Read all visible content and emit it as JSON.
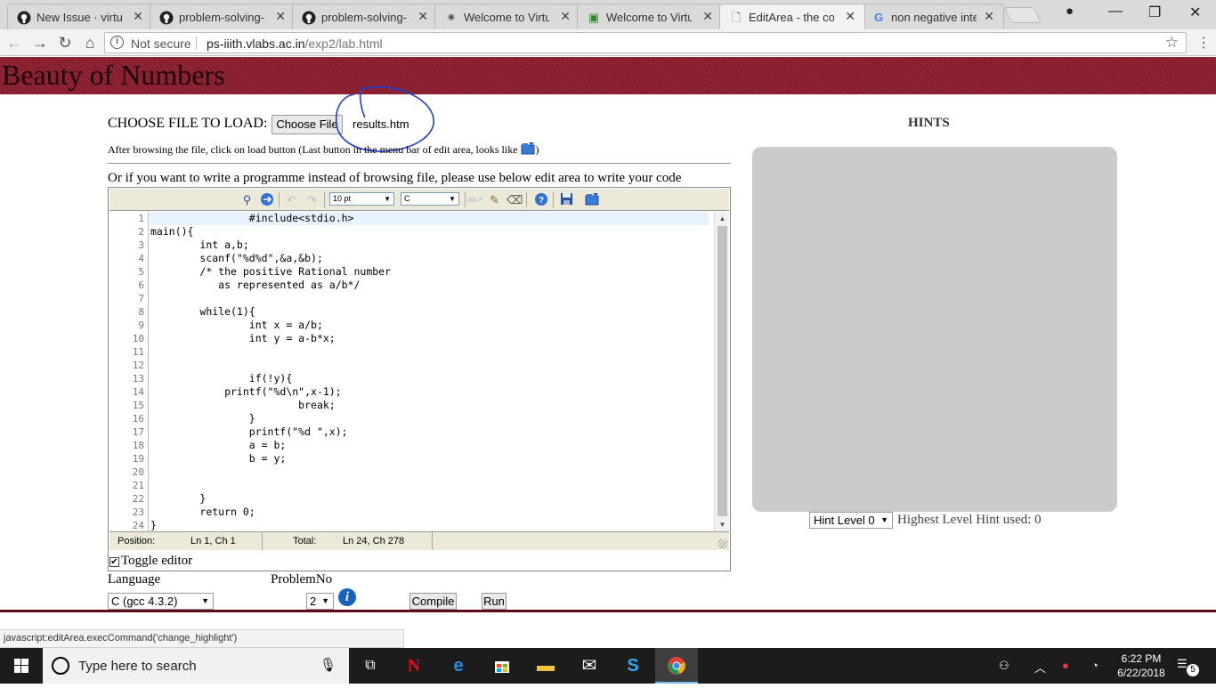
{
  "browser": {
    "tabs": [
      {
        "title": "New Issue · virtual-",
        "icon": "github-icon"
      },
      {
        "title": "problem-solving-iii",
        "icon": "github-icon"
      },
      {
        "title": "problem-solving-iii",
        "icon": "github-icon"
      },
      {
        "title": "Welcome to Virtua",
        "icon": "vlabs-icon"
      },
      {
        "title": "Welcome to Virtua",
        "icon": "vlabs-icon"
      },
      {
        "title": "EditArea - the code",
        "icon": "page-icon"
      },
      {
        "title": "non negative integ",
        "icon": "google-icon"
      }
    ],
    "security_text": "Not secure",
    "url_domain": "ps-iiith.vlabs.ac.in",
    "url_path": "/exp2/lab.html"
  },
  "page": {
    "title": "Beauty of Numbers",
    "choose_file_label": "CHOOSE FILE TO LOAD:",
    "choose_file_button": "Choose File",
    "file_name": "results.htm",
    "after_browse_text": "After browsing the file, click on load button (Last button in the menu bar of edit area, looks like",
    "after_browse_close": ")",
    "or_text": "Or if you want to write a programme instead of browsing file, please use below edit area to write your code"
  },
  "editor": {
    "font_size": "10 pt",
    "syntax": "C",
    "code_lines": [
      "\t\t#include<stdio.h>",
      "main(){",
      "\tint a,b;",
      "\tscanf(\"%d%d\",&a,&b);",
      "\t/* the positive Rational number",
      "\t   as represented as a/b*/",
      "",
      "\twhile(1){",
      "\t\tint x = a/b;",
      "\t\tint y = a-b*x;",
      "",
      "",
      "\t\tif(!y){",
      "\t    printf(\"%d\\n\",x-1);",
      "\t\t\tbreak;",
      "\t\t}",
      "\t\tprintf(\"%d \",x);",
      "\t\ta = b;",
      "\t\tb = y;",
      "",
      "",
      "\t}",
      "\treturn 0;",
      "}"
    ],
    "status": {
      "position_label": "Position:",
      "position_value": "Ln 1, Ch 1",
      "total_label": "Total:",
      "total_value": "Ln 24, Ch 278"
    },
    "toggle_label": "Toggle editor"
  },
  "controls": {
    "language_label": "Language",
    "problem_label": "ProblemNo",
    "language_value": "C (gcc 4.3.2)",
    "problem_value": "2",
    "compile_label": "Compile",
    "run_label": "Run"
  },
  "hints": {
    "title": "HINTS",
    "level_value": "Hint Level 0",
    "highest_used": "Highest Level Hint used: 0"
  },
  "status_bar_url": "javascript:editArea.execCommand('change_highlight')",
  "taskbar": {
    "search_placeholder": "Type here to search",
    "time": "6:22 PM",
    "date": "6/22/2018",
    "notification_count": "5"
  }
}
